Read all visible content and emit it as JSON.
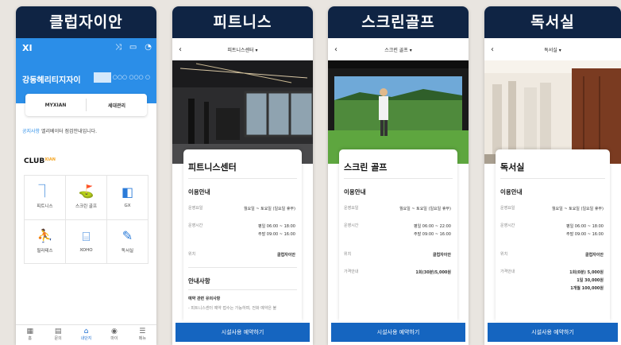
{
  "panels": {
    "home": {
      "caption": "클럽자이안",
      "logo": "XI",
      "site_name": "강동헤리티지자이",
      "site_code": "○○○ ○○○ ○",
      "card": {
        "left": "MYXIAN",
        "right": "세대관리"
      },
      "notice": {
        "label": "공지사항",
        "text": "엘리베이터 점검안내입니다."
      },
      "club": {
        "title": "CLUB",
        "badge": "XIAN"
      },
      "tiles": [
        {
          "label": "피트니스",
          "icon": "fitness-icon"
        },
        {
          "label": "스크린 골프",
          "icon": "golf-icon"
        },
        {
          "label": "GX",
          "icon": "gx-icon"
        },
        {
          "label": "필라테스",
          "icon": "pilates-icon"
        },
        {
          "label": "XOHO",
          "icon": "xoho-icon"
        },
        {
          "label": "독서실",
          "icon": "reading-room-icon"
        }
      ],
      "nav": [
        {
          "label": "홈",
          "glyph": "▦"
        },
        {
          "label": "문의",
          "glyph": "▤"
        },
        {
          "label": "내단지",
          "glyph": "⌂"
        },
        {
          "label": "마이",
          "glyph": "◉"
        },
        {
          "label": "메뉴",
          "glyph": "☰"
        }
      ]
    },
    "fitness": {
      "caption": "피트니스",
      "header": "피트니스센터 ▾",
      "title": "피트니스센터",
      "info_title": "이용안내",
      "rows": [
        {
          "label": "운영요일",
          "value": "월요일 ~ 토요일 (일요일 휴무)"
        },
        {
          "label": "운영시간",
          "value": "평일 06:00 ~ 18:00\n주말 09:00 ~ 16:00"
        },
        {
          "label": "위치",
          "value": "클럽자이안"
        }
      ],
      "notes_title": "안내사항",
      "notes_sub": "예약 관련 유의사항",
      "notes_line": "- 피트니스센터 예약 접수는 가능하며, 전화 예약은 불",
      "cta": "시설사용 예약하기"
    },
    "golf": {
      "caption": "스크린골프",
      "header": "스크린 골프 ▾",
      "title": "스크린 골프",
      "info_title": "이용안내",
      "rows": [
        {
          "label": "운영요일",
          "value": "월요일 ~ 토요일 (일요일 휴무)"
        },
        {
          "label": "운영시간",
          "value": "평일 06:00 ~ 22:00\n주말 09:00 ~ 16:00"
        },
        {
          "label": "위치",
          "value": "클럽자이안"
        },
        {
          "label": "가격안내",
          "value": "1회(30분)5,000원"
        }
      ],
      "cta": "시설사용 예약하기"
    },
    "reading": {
      "caption": "독서실",
      "header": "독서실 ▾",
      "title": "독서실",
      "info_title": "이용안내",
      "rows": [
        {
          "label": "운영요일",
          "value": "월요일 ~ 토요일 (일요일 휴무)"
        },
        {
          "label": "운영시간",
          "value": "평일 06:00 ~ 18:00\n주말 09:00 ~ 16:00"
        },
        {
          "label": "위치",
          "value": "클럽자이안"
        },
        {
          "label": "가격안내",
          "value": "1회(0분) 5,000원\n1일 30,000원\n1개월 100,000원"
        }
      ],
      "cta": "시설사용 예약하기"
    }
  },
  "colors": {
    "caption_bg": "#0f2444",
    "brand_blue": "#2b8ee8",
    "cta_blue": "#1565c0"
  }
}
